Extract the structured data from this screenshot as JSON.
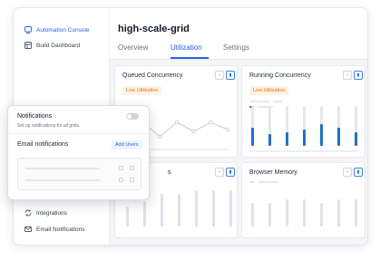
{
  "sidebar": {
    "items": [
      {
        "label": "Automation Console",
        "icon": "console-icon",
        "active": true
      },
      {
        "label": "Build Dashboard",
        "icon": "dashboard-icon",
        "active": false
      },
      {
        "label": "Integrations",
        "icon": "integrations-icon",
        "active": false
      },
      {
        "label": "Email Notifications",
        "icon": "email-notifications-icon",
        "active": false
      }
    ]
  },
  "header": {
    "title": "high-scale-grid",
    "tabs": [
      {
        "label": "Overview",
        "active": false
      },
      {
        "label": "Utilization",
        "active": true
      },
      {
        "label": "Settings",
        "active": false
      }
    ]
  },
  "cards": [
    {
      "title": "Queued Concurrency",
      "badge": "Low Utilization",
      "type": "line",
      "points": [
        0.25,
        0.55,
        0.15,
        0.55,
        0.3,
        0.55,
        0.35
      ]
    },
    {
      "title": "Running Concurrency",
      "badge": "Low Utilization",
      "type": "bars",
      "levels": [
        0.45,
        0.3,
        0.35,
        0.4,
        0.55,
        0.45,
        0.35
      ]
    },
    {
      "title": "Sessions",
      "type": "bars-gray"
    },
    {
      "title": "Browser Memory",
      "type": "bars-gray"
    }
  ],
  "notifications": {
    "title": "Notifications",
    "subtitle": "Set up notifications for all grids.",
    "toggle_on": false,
    "email_label": "Email notifications",
    "add_button": "Add Users"
  },
  "colors": {
    "accent": "#2563eb",
    "bar": "#1d6fe0",
    "badge_text": "#d97706",
    "badge_bg": "#fdf2e4"
  }
}
